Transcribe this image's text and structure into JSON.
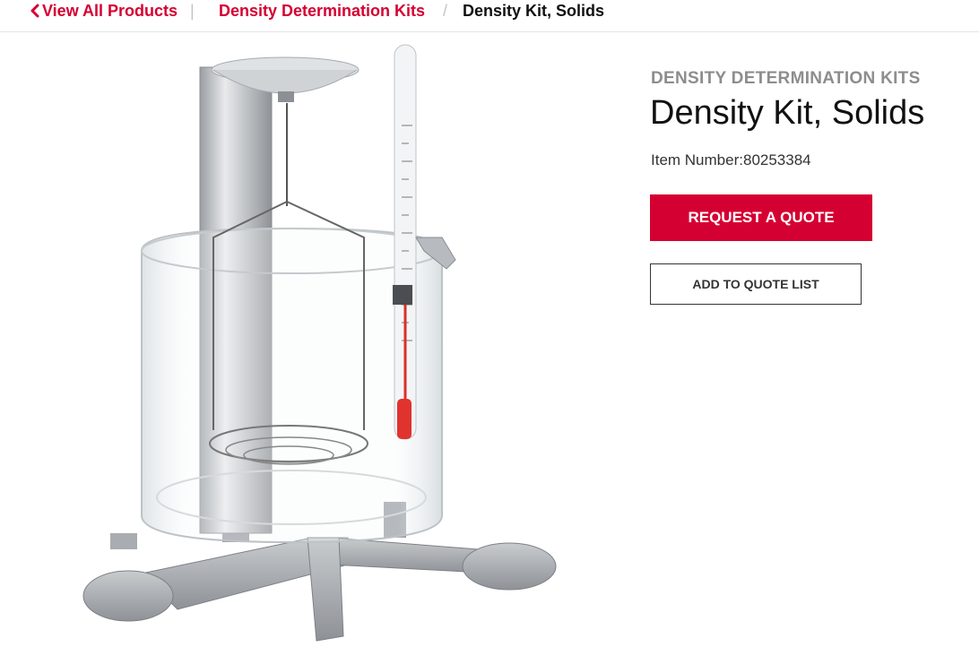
{
  "breadcrumb": {
    "back_label": "View All Products",
    "category_label": "Density Determination Kits",
    "current_label": "Density Kit, Solids",
    "separator": "/",
    "divider": "|"
  },
  "product": {
    "category": "DENSITY DETERMINATION KITS",
    "title": "Density Kit, Solids",
    "item_number_label": "Item Number:",
    "item_number": "80253384",
    "image_name": "density-kit-solids-photo"
  },
  "actions": {
    "request_quote_label": "REQUEST A QUOTE",
    "add_to_list_label": "ADD TO QUOTE LIST"
  },
  "colors": {
    "brand_red": "#d50032",
    "text_dark": "#111111",
    "category_gray": "#8d8d8d"
  },
  "icons": {
    "back": "chevron-left-icon"
  }
}
